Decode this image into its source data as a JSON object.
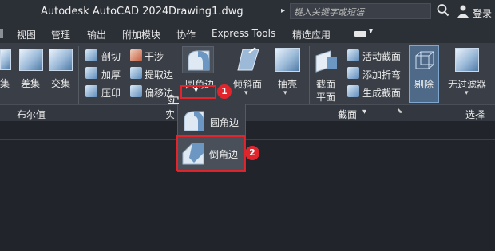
{
  "title_bar": {
    "app_title": "Autodesk AutoCAD 2024",
    "document": "Drawing1.dwg",
    "search_placeholder": "键入关键字或短语",
    "login": "登录"
  },
  "menu": [
    "视图",
    "管理",
    "输出",
    "附加模块",
    "协作",
    "Express Tools",
    "精选应用"
  ],
  "ribbon": {
    "boolean": {
      "union_partial": "集",
      "subtract": "差集",
      "intersect": "交集",
      "panel_label": "布尔值"
    },
    "solid_edit_small": [
      "剖切",
      "干涉",
      "加厚",
      "提取边",
      "压印",
      "偏移边"
    ],
    "fillet_edge": "圆角边",
    "taper": "倾斜面",
    "shell": "抽壳",
    "panel_partial": "实",
    "section": {
      "plane": "截面\n平面",
      "live": "活动截面",
      "add_jog": "添加折弯",
      "generate": "生成截面",
      "panel_label": "截面"
    },
    "culling": "剔除",
    "filter": "无过滤器",
    "select_panel": "选择"
  },
  "dropdown": {
    "items": [
      "圆角边",
      "倒角边"
    ]
  },
  "badges": [
    "1",
    "2"
  ],
  "colors": {
    "accent_red": "#e0262c",
    "ribbon_bg": "#3a3f47",
    "canvas_bg": "#21252b"
  }
}
